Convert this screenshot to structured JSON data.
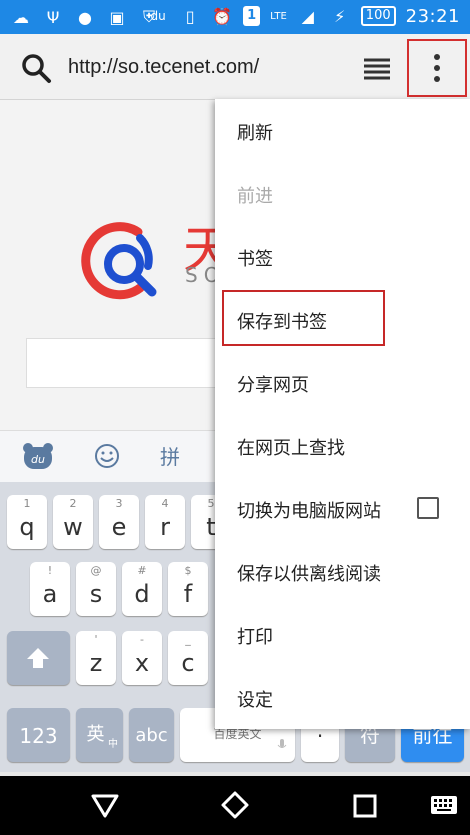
{
  "status_bar": {
    "time": "23:21",
    "notification_count": "1",
    "network": "LTE",
    "battery": "100",
    "colors": {
      "background": "#1e88e5"
    }
  },
  "browser": {
    "url": "http://so.tecenet.com/"
  },
  "page": {
    "brand_char": "天",
    "brand_sub": "SO"
  },
  "menu": {
    "items": [
      {
        "label": "刷新",
        "enabled": true
      },
      {
        "label": "前进",
        "enabled": false
      },
      {
        "label": "书签",
        "enabled": true
      },
      {
        "label": "保存到书签",
        "enabled": true,
        "highlighted": true
      },
      {
        "label": "分享网页",
        "enabled": true
      },
      {
        "label": "在网页上查找",
        "enabled": true
      },
      {
        "label": "切换为电脑版网站",
        "enabled": true,
        "checkbox": true,
        "checked": false
      },
      {
        "label": "保存以供离线阅读",
        "enabled": true
      },
      {
        "label": "打印",
        "enabled": true
      },
      {
        "label": "设定",
        "enabled": true
      }
    ]
  },
  "keyboard": {
    "toolbar": {
      "pinyin": "拼"
    },
    "row1": [
      {
        "hint": "1",
        "ch": "q"
      },
      {
        "hint": "2",
        "ch": "w"
      },
      {
        "hint": "3",
        "ch": "e"
      },
      {
        "hint": "4",
        "ch": "r"
      },
      {
        "hint": "5",
        "ch": "t"
      }
    ],
    "row2": [
      {
        "hint": "!",
        "ch": "a"
      },
      {
        "hint": "@",
        "ch": "s"
      },
      {
        "hint": "#",
        "ch": "d"
      },
      {
        "hint": "$",
        "ch": "f"
      }
    ],
    "row3": [
      {
        "hint": "'",
        "ch": "z"
      },
      {
        "hint": "-",
        "ch": "x"
      },
      {
        "hint": "_",
        "ch": "c"
      }
    ],
    "bottom": {
      "num": "123",
      "lang": "英",
      "lang_sub": "中",
      "abc": "abc",
      "space": "百度英文",
      "dot": "·",
      "symbol": "符",
      "go": "前往"
    }
  }
}
